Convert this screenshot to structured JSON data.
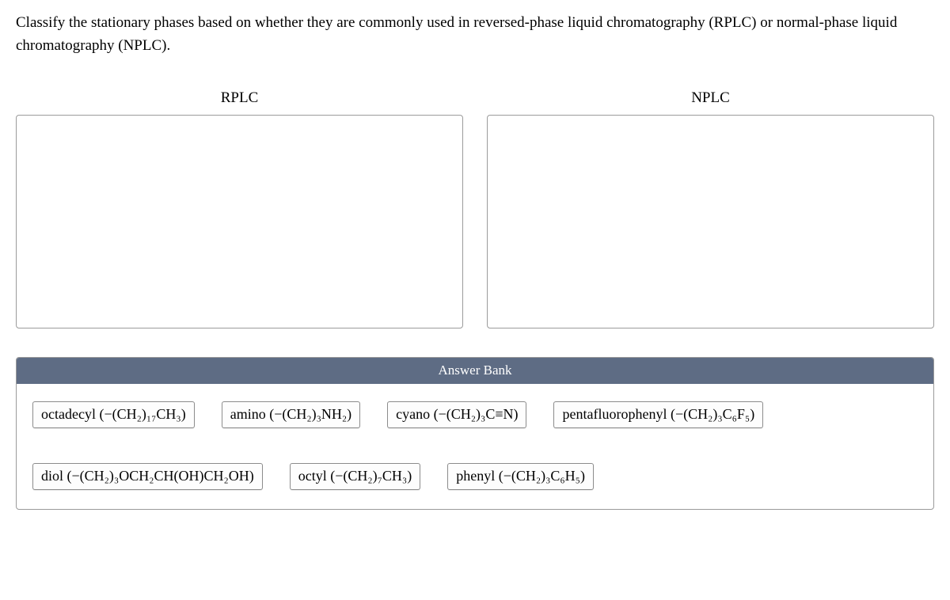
{
  "question": "Classify the stationary phases based on whether they are commonly used in reversed-phase liquid chromatography (RPLC) or normal-phase liquid chromatography (NPLC).",
  "zones": {
    "left": "RPLC",
    "right": "NPLC"
  },
  "bank_header": "Answer Bank",
  "chips": {
    "c0": "octadecyl (−(CH₂)₁₇CH₃)",
    "c1": "amino (−(CH₂)₃NH₂)",
    "c2": "cyano (−(CH₂)₃C≡N)",
    "c3": "pentafluorophenyl (−(CH₂)₃C₆F₅)",
    "c4": "diol (−(CH₂)₃OCH₂CH(OH)CH₂OH)",
    "c5": "octyl (−(CH₂)₇CH₃)",
    "c6": "phenyl (−(CH₂)₃C₆H₅)"
  }
}
